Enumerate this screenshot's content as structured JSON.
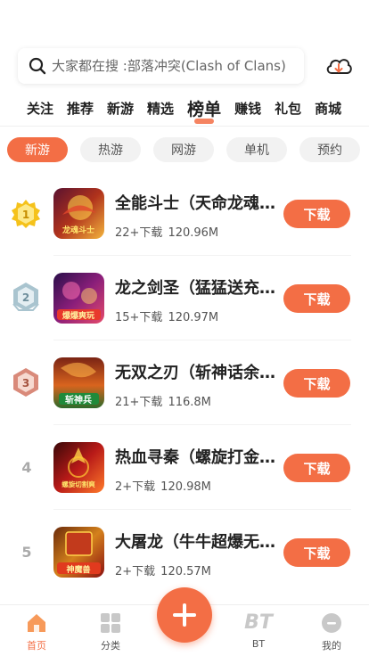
{
  "search": {
    "placeholder": "大家都在搜 :部落冲突(Clash of Clans)"
  },
  "nav_tabs": [
    {
      "label": "关注"
    },
    {
      "label": "推荐"
    },
    {
      "label": "新游"
    },
    {
      "label": "精选"
    },
    {
      "label": "榜单",
      "active": true
    },
    {
      "label": "赚钱"
    },
    {
      "label": "礼包"
    },
    {
      "label": "商城"
    }
  ],
  "chips": [
    {
      "label": "新游",
      "active": true
    },
    {
      "label": "热游"
    },
    {
      "label": "网游"
    },
    {
      "label": "单机"
    },
    {
      "label": "预约"
    }
  ],
  "games": [
    {
      "rank": "1",
      "name": "全能斗士（天命龙魂…",
      "downloads": "22+下载",
      "size": "120.96M",
      "button": "下载",
      "icon_text": "龙魂斗士"
    },
    {
      "rank": "2",
      "name": "龙之剑圣（猛猛送充…",
      "downloads": "15+下载",
      "size": "120.97M",
      "button": "下载",
      "icon_text": "爆爆爽玩"
    },
    {
      "rank": "3",
      "name": "无双之刃（斩神话余…",
      "downloads": "21+下载",
      "size": "116.8M",
      "button": "下载",
      "icon_text": "斩神兵"
    },
    {
      "rank": "4",
      "name": "热血寻秦（螺旋打金…",
      "downloads": "2+下载",
      "size": "120.98M",
      "button": "下载",
      "icon_text": "螺旋切割爽"
    },
    {
      "rank": "5",
      "name": "大屠龙（牛牛超爆无…",
      "downloads": "2+下载",
      "size": "120.57M",
      "button": "下载",
      "icon_text": "神魔兽"
    }
  ],
  "bottom_nav": [
    {
      "label": "首页",
      "active": true
    },
    {
      "label": "分类"
    },
    {
      "label": "BT",
      "icon_text": "BT"
    },
    {
      "label": "我的"
    }
  ],
  "colors": {
    "accent": "#f36e45",
    "gold": "#f5c21b",
    "silver": "#a9c4cf",
    "bronze": "#d98a7a"
  }
}
